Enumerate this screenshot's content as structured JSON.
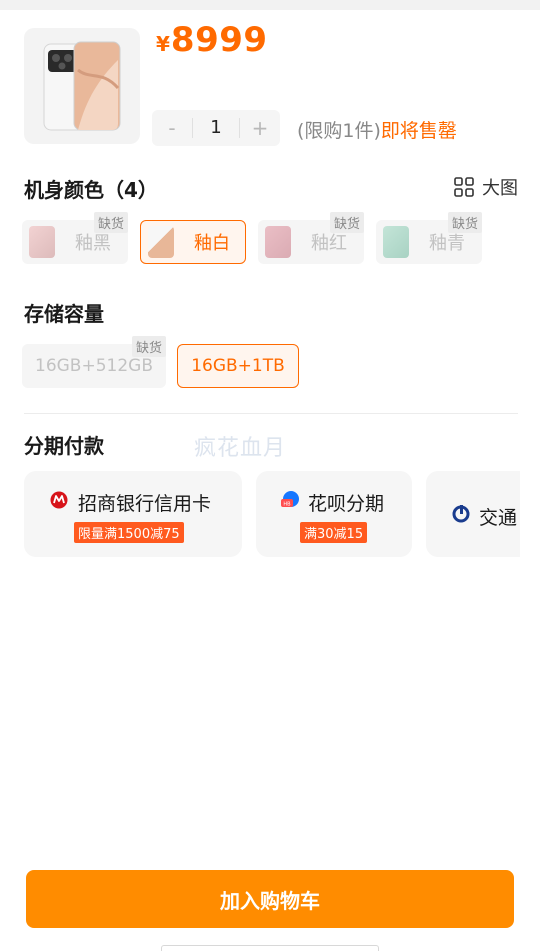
{
  "product": {
    "currency": "¥",
    "price": "8999",
    "quantity": "1",
    "minus": "-",
    "plus": "+",
    "limit_text": "(限购1件)",
    "limit_status": "即将售罄"
  },
  "colors": {
    "title": "机身颜色（4）",
    "big_view_label": "大图",
    "out_of_stock_label": "缺货",
    "options": [
      {
        "label": "釉黑",
        "selected": false,
        "out_of_stock": true
      },
      {
        "label": "釉白",
        "selected": true,
        "out_of_stock": false
      },
      {
        "label": "釉红",
        "selected": false,
        "out_of_stock": true
      },
      {
        "label": "釉青",
        "selected": false,
        "out_of_stock": true
      }
    ]
  },
  "storage": {
    "title": "存储容量",
    "out_of_stock_label": "缺货",
    "options": [
      {
        "label": "16GB+512GB",
        "selected": false,
        "out_of_stock": true
      },
      {
        "label": "16GB+1TB",
        "selected": true,
        "out_of_stock": false
      }
    ]
  },
  "watermark": "疯花血月",
  "installment": {
    "title": "分期付款",
    "options": [
      {
        "name": "招商银行信用卡",
        "promo": "限量满1500减75",
        "icon": "cmb-bank-icon"
      },
      {
        "name": "花呗分期",
        "promo": "满30减15",
        "icon": "huabei-icon"
      },
      {
        "name": "交通",
        "promo": "",
        "icon": "bocom-bank-icon"
      }
    ]
  },
  "cart_button": "加入购物车",
  "theme": {
    "accent": "#ff6a00",
    "button": "#ff8c00"
  }
}
